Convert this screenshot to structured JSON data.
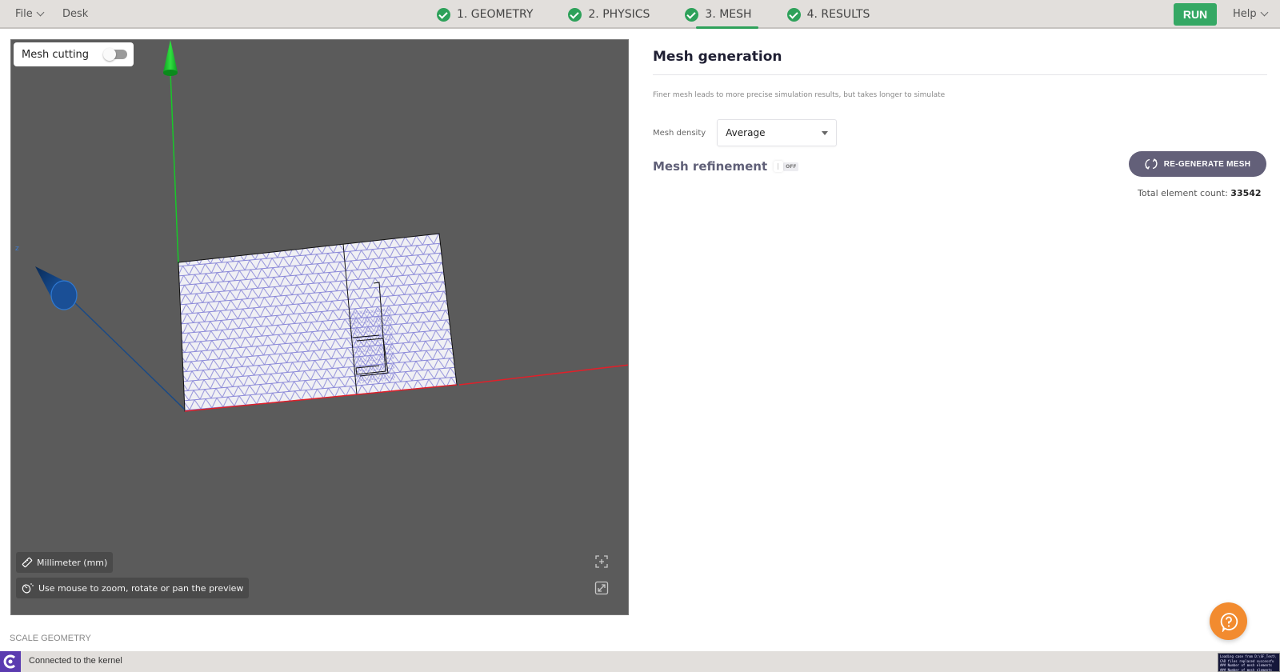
{
  "topbar": {
    "file_label": "File",
    "desk_label": "Desk",
    "steps": [
      {
        "label": "1. GEOMETRY",
        "status": "complete",
        "active": false
      },
      {
        "label": "2. PHYSICS",
        "status": "complete",
        "active": false
      },
      {
        "label": "3. MESH",
        "status": "complete",
        "active": true
      },
      {
        "label": "4. RESULTS",
        "status": "complete",
        "active": false
      }
    ],
    "run_label": "RUN",
    "help_label": "Help",
    "accent_color": "#35a864"
  },
  "viewport": {
    "mesh_cutting_label": "Mesh cutting",
    "mesh_cutting_enabled": false,
    "axis_label_z": "z",
    "units_label": "Millimeter (mm)",
    "hint_label": "Use mouse to zoom, rotate or pan the preview",
    "axis_colors": {
      "x": "#e0202a",
      "y": "#12c02a",
      "z": "#1558a8"
    },
    "mesh_color": "#8a88d8"
  },
  "panel": {
    "title": "Mesh generation",
    "description": "Finer mesh leads to more precise simulation results, but takes longer to simulate",
    "density_label": "Mesh density",
    "density_value": "Average",
    "refinement_label": "Mesh refinement",
    "refinement_state": "OFF",
    "regenerate_label": "RE-GENERATE MESH",
    "element_count_label": "Total element count:",
    "element_count_value": "33542"
  },
  "footer": {
    "scale_geometry_label": "SCALE GEOMETRY",
    "status_text": "Connected to the kernel",
    "log_lines": [
      "Loading case from D:\\SF_Test\\",
      "CAD files replaced successfu",
      "### Number of mesh elements",
      "### Number of mesh elements"
    ]
  }
}
